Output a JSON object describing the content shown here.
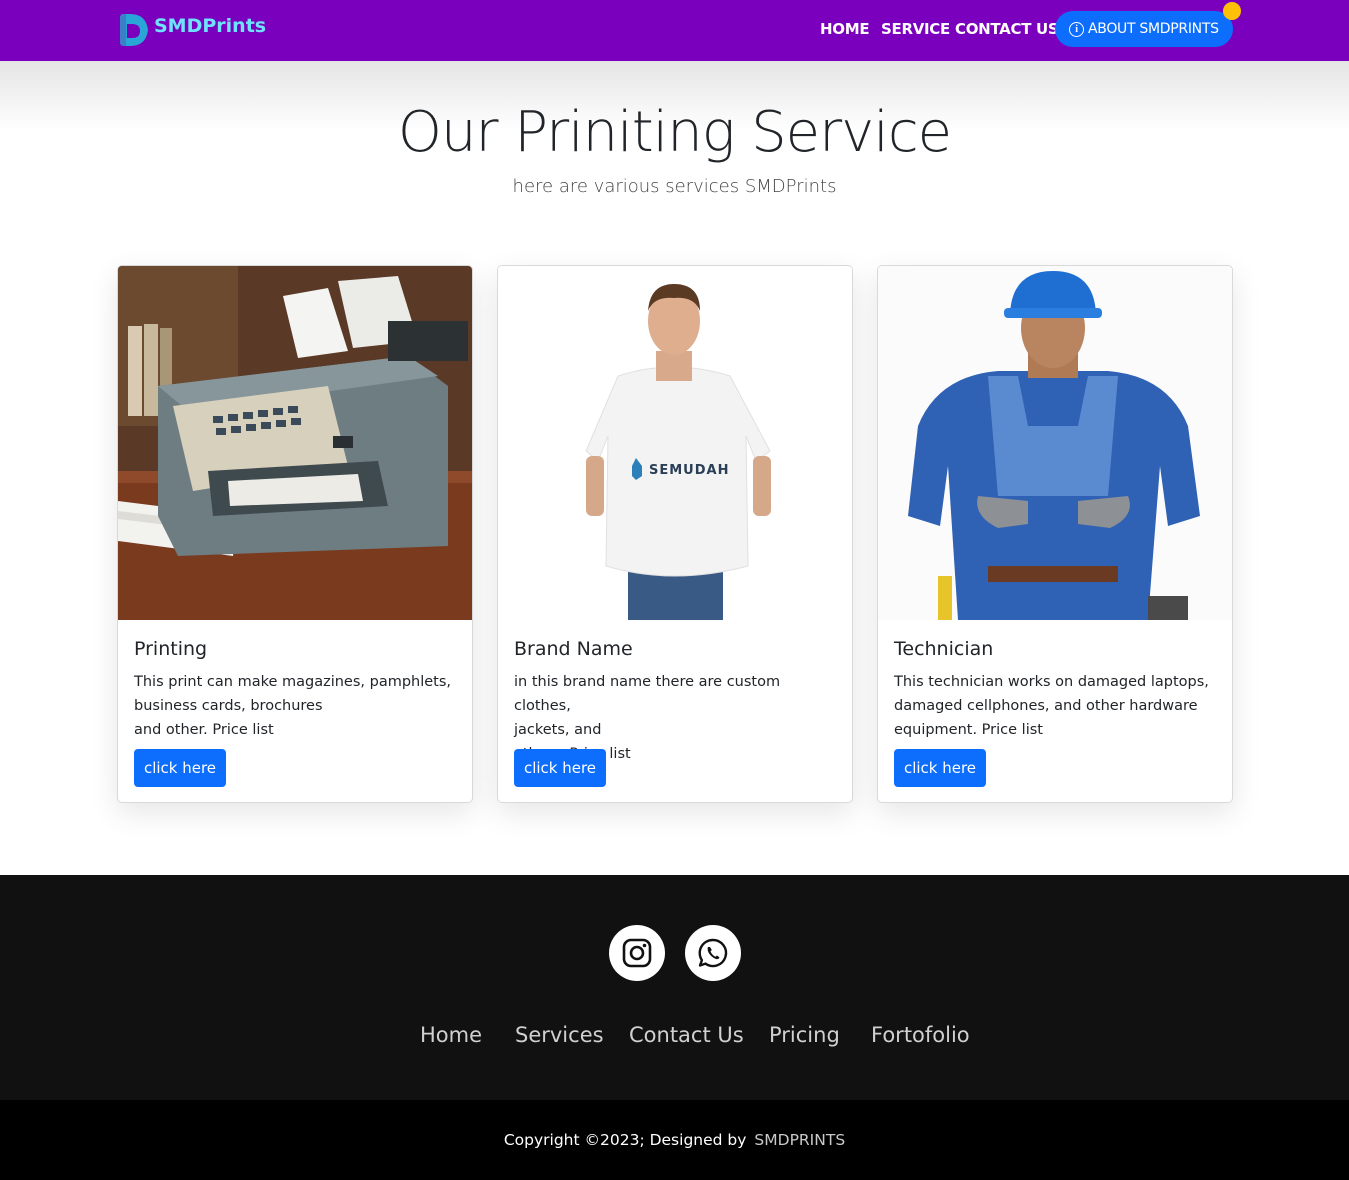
{
  "navbar": {
    "brand": "SMDPrints",
    "links": [
      "HOME",
      "SERVICE",
      "CONTACT US"
    ],
    "about_label": "ABOUT SMDPRINTS",
    "bg_color": "#7b00bd",
    "accent": "#0d6efd"
  },
  "hero": {
    "title": "Our Priniting Service",
    "subtitle": "here are various services SMDPrints"
  },
  "cards": [
    {
      "title": "Printing",
      "text_lines": [
        "This print can make magazines, pamphlets,",
        "business cards, brochures",
        "and other. Price list"
      ],
      "button": "click here",
      "image": "printer-photo"
    },
    {
      "title": "Brand Name",
      "text_lines": [
        "in this brand name there are custom clothes,",
        "jackets, and",
        "others. Price list"
      ],
      "button": "click here",
      "image": "tshirt-model-photo",
      "shirt_logo": "SEMUDAH"
    },
    {
      "title": "Technician",
      "text_lines": [
        "This technician works on damaged laptops,",
        "damaged cellphones, and other hardware",
        "equipment. Price list"
      ],
      "button": "click here",
      "image": "technician-photo"
    }
  ],
  "footer": {
    "social": [
      "instagram-icon",
      "whatsapp-icon"
    ],
    "links": [
      "Home",
      "Services",
      "Contact Us",
      "Pricing",
      "Fortofolio"
    ],
    "copyright": "Copyright ©2023; Designed by",
    "copyright_brand": "SMDPRINTS"
  }
}
